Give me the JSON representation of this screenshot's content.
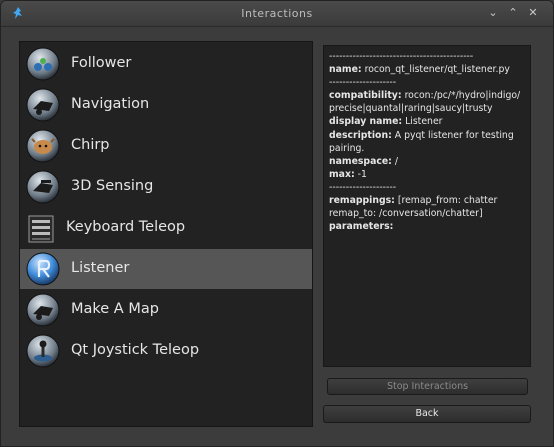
{
  "window": {
    "title": "Interactions",
    "min_glyph": "⌄",
    "max_glyph": "⌃",
    "close_glyph": "✕",
    "app_icon": "turtle-icon"
  },
  "interactions": [
    {
      "label": "Follower",
      "icon": "follower-icon"
    },
    {
      "label": "Navigation",
      "icon": "navigation-icon"
    },
    {
      "label": "Chirp",
      "icon": "chirp-icon"
    },
    {
      "label": "3D Sensing",
      "icon": "3d-sensing-icon"
    },
    {
      "label": "Keyboard Teleop",
      "icon": "keyboard-teleop-icon"
    },
    {
      "label": "Listener",
      "icon": "listener-icon",
      "selected": true
    },
    {
      "label": "Make A Map",
      "icon": "make-a-map-icon"
    },
    {
      "label": "Qt Joystick Teleop",
      "icon": "joystick-icon"
    }
  ],
  "details": {
    "separator": "-------------------------------------------",
    "name_key": "name:",
    "name_val": "rocon_qt_listener/qt_listener.py",
    "separator2": "--------------------",
    "compat_key": "compatibility:",
    "compat_val": "rocon:/pc/*/hydro|indigo/precise|quantal|raring|saucy|trusty",
    "display_key": "display name:",
    "display_val": "Listener",
    "desc_key": "description:",
    "desc_val": "A pyqt listener for testing pairing.",
    "ns_key": "namespace:",
    "ns_val": "/",
    "max_key": "max:",
    "max_val": "-1",
    "separator3": "--------------------",
    "remap_key": "remappings:",
    "remap_val": "[remap_from: chatter remap_to: /conversation/chatter]",
    "params_key": "parameters:"
  },
  "buttons": {
    "stop_label": "Stop Interactions",
    "back_label": "Back"
  }
}
